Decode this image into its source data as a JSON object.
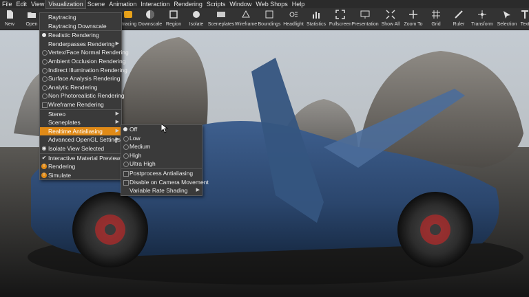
{
  "menubar": [
    "File",
    "Edit",
    "View",
    "Visualization",
    "Scene",
    "Animation",
    "Interaction",
    "Rendering",
    "Scripts",
    "Window",
    "Web Shops",
    "Help"
  ],
  "toolbar": [
    {
      "label": "New",
      "icon": "new-file-icon"
    },
    {
      "label": "Open",
      "icon": "folder-icon"
    },
    {
      "label": "ytracing",
      "icon": "raytracing-icon"
    },
    {
      "label": "Downscale",
      "icon": "downscale-icon"
    },
    {
      "label": "Region",
      "icon": "region-icon"
    },
    {
      "label": "Isolate",
      "icon": "isolate-icon"
    },
    {
      "label": "Sceneplates",
      "icon": "sceneplates-icon"
    },
    {
      "label": "Wireframe",
      "icon": "wireframe-icon"
    },
    {
      "label": "Boundings",
      "icon": "boundings-icon"
    },
    {
      "label": "Headlight",
      "icon": "headlight-icon"
    },
    {
      "label": "Statistics",
      "icon": "statistics-icon"
    },
    {
      "label": "Fullscreen",
      "icon": "fullscreen-icon"
    },
    {
      "label": "Presentation",
      "icon": "presentation-icon"
    },
    {
      "label": "Show All",
      "icon": "show-all-icon"
    },
    {
      "label": "Zoom To",
      "icon": "zoom-to-icon"
    },
    {
      "label": "Grid",
      "icon": "grid-icon"
    },
    {
      "label": "Ruler",
      "icon": "ruler-icon"
    },
    {
      "label": "Transform",
      "icon": "transform-icon"
    },
    {
      "label": "Selection",
      "icon": "selection-icon"
    },
    {
      "label": "Text",
      "icon": "text-icon"
    }
  ],
  "visualization_menu": [
    {
      "label": "Raytracing",
      "mark": "none",
      "sub": false
    },
    {
      "label": "Raytracing Downscale",
      "mark": "none",
      "sub": false
    },
    {
      "label": "Realistic Rendering",
      "mark": "radio-on",
      "sub": false,
      "sep": true
    },
    {
      "label": "Renderpasses Rendering",
      "mark": "none",
      "sub": true
    },
    {
      "label": "Vertex/Face Normal Rendering",
      "mark": "radio-off",
      "sub": false
    },
    {
      "label": "Ambient Occlusion Rendering",
      "mark": "radio-off",
      "sub": false
    },
    {
      "label": "Indirect Illumination Rendering",
      "mark": "radio-off",
      "sub": false
    },
    {
      "label": "Surface Analysis Rendering",
      "mark": "radio-off",
      "sub": false
    },
    {
      "label": "Analytic Rendering",
      "mark": "radio-off",
      "sub": false
    },
    {
      "label": "Non Photorealistic Rendering",
      "mark": "radio-off",
      "sub": false
    },
    {
      "label": "Wireframe Rendering",
      "mark": "chk",
      "sub": false
    },
    {
      "label": "Stereo",
      "mark": "none",
      "sub": true,
      "sep": true
    },
    {
      "label": "Sceneplates",
      "mark": "none",
      "sub": true
    },
    {
      "label": "Realtime Antialiasing",
      "mark": "none",
      "sub": true,
      "highlight": true
    },
    {
      "label": "Advanced OpenGL Settings",
      "mark": "none",
      "sub": true
    },
    {
      "label": "Isolate View Selected",
      "mark": "eye",
      "sub": false
    },
    {
      "label": "Interactive Material Preview",
      "mark": "check",
      "sub": false,
      "sep": true
    },
    {
      "label": "Rendering",
      "mark": "orange",
      "sub": false
    },
    {
      "label": "Simulate",
      "mark": "orange",
      "sub": false
    }
  ],
  "antialiasing_menu": [
    {
      "label": "Off",
      "mark": "radio-on"
    },
    {
      "label": "Low",
      "mark": "radio-off"
    },
    {
      "label": "Medium",
      "mark": "radio-off"
    },
    {
      "label": "High",
      "mark": "radio-off"
    },
    {
      "label": "Ultra High",
      "mark": "radio-off"
    },
    {
      "label": "Postprocess Antialiasing",
      "mark": "chk",
      "sep": true
    },
    {
      "label": "Disable on Camera Movement",
      "mark": "chk"
    },
    {
      "label": "Variable Rate Shading",
      "mark": "none",
      "sub": true
    }
  ]
}
